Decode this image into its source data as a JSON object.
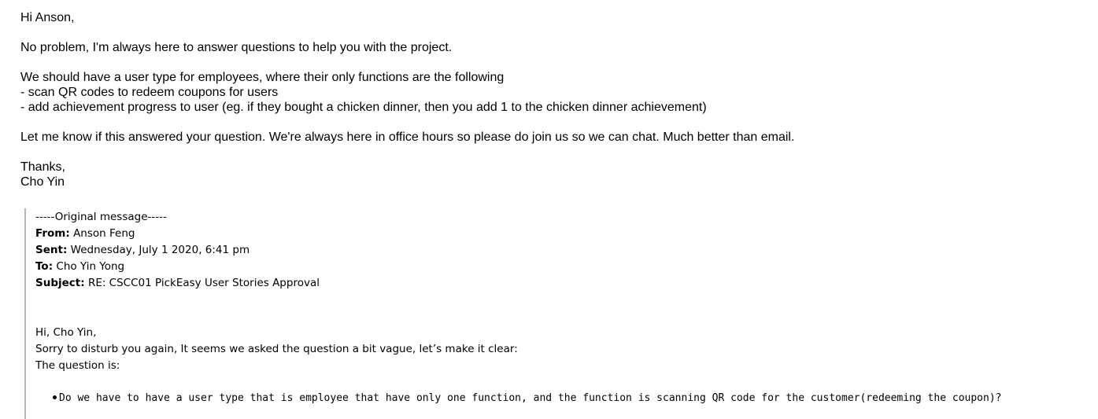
{
  "reply": {
    "greeting": "Hi Anson,",
    "line1": "No problem, I'm always here to answer questions to help you with the project.",
    "line2": "We should have a user type for employees, where their only functions are the following",
    "bullet1": "- scan QR codes to redeem coupons for users",
    "bullet2": "- add achievement progress to user (eg. if they bought a chicken dinner, then you add 1 to the chicken dinner achievement)",
    "line3": "Let me know if this answered your question. We're always here in office hours so please do join us so we can chat. Much better than email.",
    "signoff": "Thanks,",
    "signature": "Cho Yin"
  },
  "original": {
    "header": "-----Original message-----",
    "from_label": "From:",
    "from_value": "Anson Feng",
    "sent_label": "Sent:",
    "sent_value": "Wednesday, July 1 2020, 6:41 pm",
    "to_label": "To:",
    "to_value": "Cho Yin Yong",
    "subject_label": "Subject:",
    "subject_value": "RE: CSCC01 PickEasy User Stories Approval",
    "greeting": "Hi, Cho Yin,",
    "line1": "Sorry to disturb you again, It seems we asked the question a bit vague, let’s make it clear:",
    "line2": "The question is:",
    "question": "Do we have to have a user type that is employee that have only one function, and the function is scanning QR code for the customer(redeeming the coupon)?"
  }
}
